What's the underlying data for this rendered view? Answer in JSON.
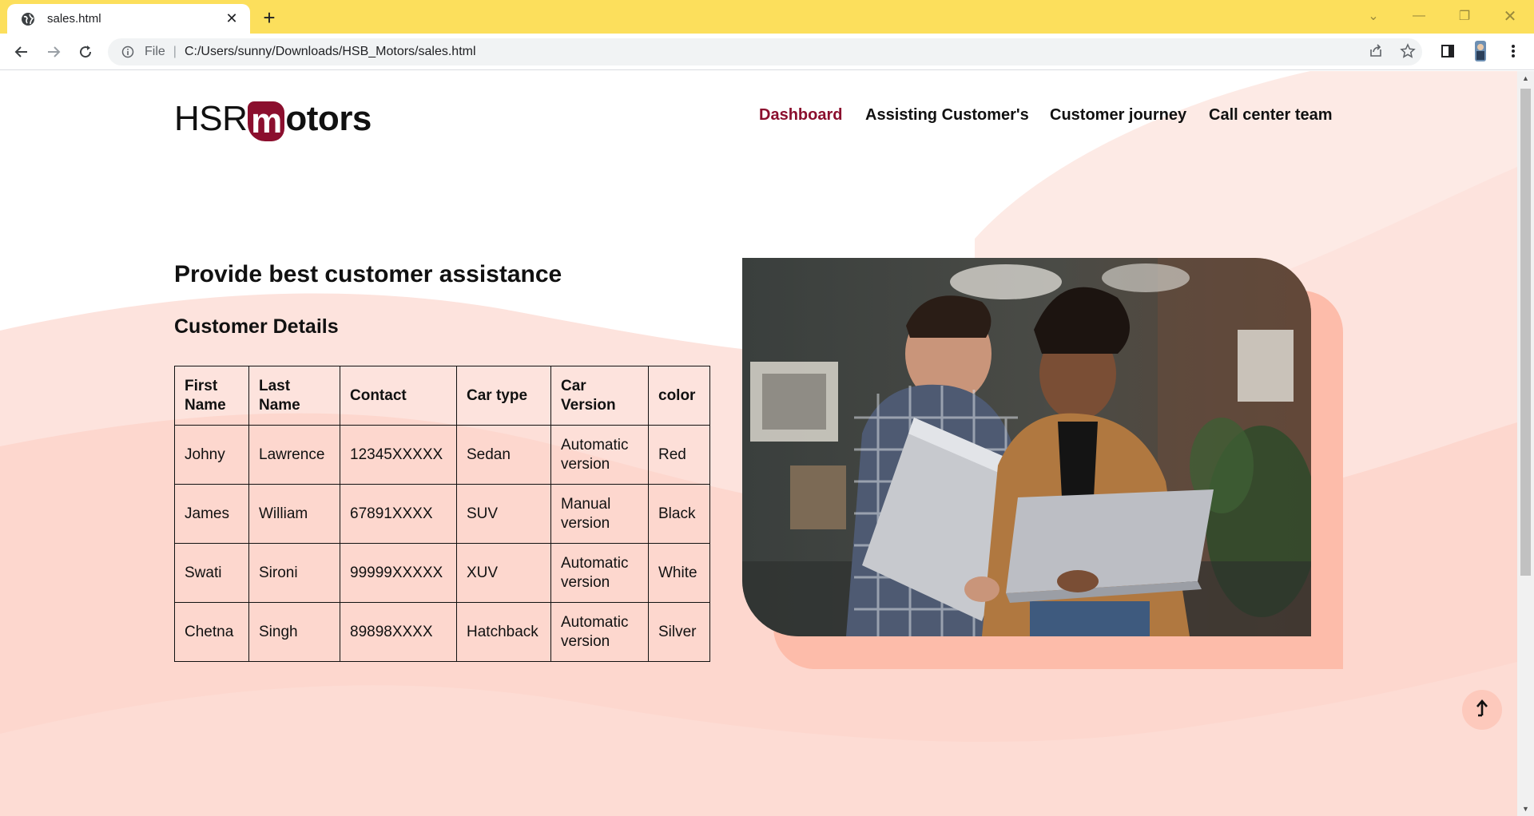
{
  "browser": {
    "tab_title": "sales.html",
    "omnibox_scheme": "File",
    "omnibox_url": "C:/Users/sunny/Downloads/HSB_Motors/sales.html"
  },
  "page": {
    "logo_prefix": "HSR",
    "logo_mark": "m",
    "logo_suffix": "otors",
    "nav": [
      "Dashboard",
      "Assisting Customer's",
      "Customer journey",
      "Call center team"
    ],
    "headline": "Provide best customer assistance",
    "subhead": "Customer Details",
    "table": {
      "headers": [
        "First Name",
        "Last Name",
        "Contact",
        "Car type",
        "Car Version",
        "color"
      ],
      "rows": [
        [
          "Johny",
          "Lawrence",
          "12345XXXXX",
          "Sedan",
          "Automatic version",
          "Red"
        ],
        [
          "James",
          "William",
          "67891XXXX",
          "SUV",
          "Manual version",
          "Black"
        ],
        [
          "Swati",
          "Sironi",
          "99999XXXXX",
          "XUV",
          "Automatic version",
          "White"
        ],
        [
          "Chetna",
          "Singh",
          "89898XXXX",
          "Hatchback",
          "Automatic version",
          "Silver"
        ]
      ]
    }
  },
  "colors": {
    "chrome_frame": "#fcdf5c",
    "brand_maroon": "#8b0f2e",
    "accent_peach": "#fdbcaa",
    "background_wave": "#fde4de"
  },
  "icons": [
    "globe-icon",
    "close-icon",
    "plus-icon",
    "back-icon",
    "forward-icon",
    "reload-icon",
    "info-icon",
    "share-icon",
    "star-icon",
    "side-panel-icon",
    "profile-avatar-icon",
    "kebab-menu-icon",
    "arrow-up-icon"
  ]
}
